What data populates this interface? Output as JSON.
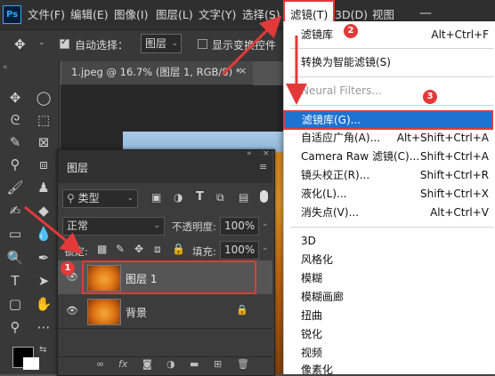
{
  "app": {
    "logo_text": "Ps"
  },
  "menubar": {
    "items": [
      {
        "label": "文件(F)"
      },
      {
        "label": "编辑(E)"
      },
      {
        "label": "图像(I)"
      },
      {
        "label": "图层(L)"
      },
      {
        "label": "文字(Y)"
      },
      {
        "label": "选择(S)"
      },
      {
        "label": "滤镜(T)"
      },
      {
        "label": "3D(D)"
      },
      {
        "label": "视图"
      }
    ],
    "minimize": "—"
  },
  "options_bar": {
    "auto_select_label": "自动选择：",
    "auto_select_checked": true,
    "target_value": "图层",
    "show_transform_label": "显示变换控件"
  },
  "document_tab": {
    "title": "1.jpeg @ 16.7% (图层 1, RGB/8) *",
    "close": "×"
  },
  "layers_panel": {
    "title": "图层",
    "filter_kind": "类型",
    "blend_mode": "正常",
    "opacity_label": "不透明度:",
    "opacity_value": "100%",
    "lock_label": "锁定:",
    "fill_label": "填充:",
    "fill_value": "100%",
    "layers": [
      {
        "name": "图层 1",
        "selected": true,
        "locked": false
      },
      {
        "name": "背景",
        "selected": false,
        "locked": true
      }
    ]
  },
  "filter_menu": {
    "items": [
      {
        "label": "滤镜库",
        "shortcut": "Alt+Ctrl+F",
        "disabled": false
      },
      {
        "label": "转换为智能滤镜(S)",
        "shortcut": "",
        "disabled": false
      },
      {
        "label": "Neural Filters...",
        "shortcut": "",
        "disabled": true
      },
      {
        "label": "滤镜库(G)...",
        "shortcut": "",
        "disabled": false,
        "highlighted": true
      },
      {
        "label": "自适应广角(A)...",
        "shortcut": "Alt+Shift+Ctrl+A",
        "disabled": false
      },
      {
        "label": "Camera Raw 滤镜(C)...",
        "shortcut": "Shift+Ctrl+A",
        "disabled": false
      },
      {
        "label": "镜头校正(R)...",
        "shortcut": "Shift+Ctrl+R",
        "disabled": false
      },
      {
        "label": "液化(L)...",
        "shortcut": "Shift+Ctrl+X",
        "disabled": false
      },
      {
        "label": "消失点(V)...",
        "shortcut": "Alt+Ctrl+V",
        "disabled": false
      },
      {
        "label": "3D",
        "shortcut": "",
        "disabled": false
      },
      {
        "label": "风格化",
        "shortcut": "",
        "disabled": false
      },
      {
        "label": "模糊",
        "shortcut": "",
        "disabled": false
      },
      {
        "label": "模糊画廊",
        "shortcut": "",
        "disabled": false
      },
      {
        "label": "扭曲",
        "shortcut": "",
        "disabled": false
      },
      {
        "label": "锐化",
        "shortcut": "",
        "disabled": false
      },
      {
        "label": "视频",
        "shortcut": "",
        "disabled": false
      },
      {
        "label": "像素化",
        "shortcut": "",
        "disabled": false
      }
    ]
  },
  "annotations": {
    "step1": "1",
    "step2": "2",
    "step3": "3"
  },
  "colors": {
    "highlight": "#1d73d2",
    "annotation_red": "#e23a3a",
    "foreground": "#000000",
    "background": "#ffffff"
  }
}
